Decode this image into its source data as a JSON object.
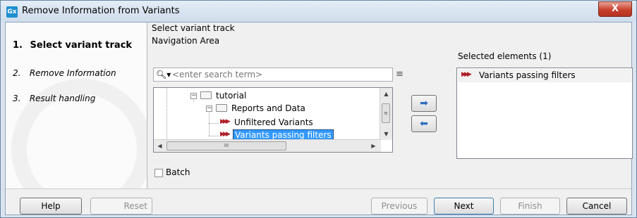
{
  "window": {
    "title": "Remove Information from Variants",
    "app_icon": "Gx",
    "close_label": "X"
  },
  "steps": [
    {
      "num": "1.",
      "label": "Select variant track"
    },
    {
      "num": "2.",
      "label": "Remove Information"
    },
    {
      "num": "3.",
      "label": "Result handling"
    }
  ],
  "main": {
    "section_label": "Select variant track",
    "navigation_label": "Navigation Area",
    "search_placeholder": "<enter search term>",
    "tree": [
      {
        "label": "tutorial"
      },
      {
        "label": "Reports and Data"
      },
      {
        "label": "Unfiltered Variants"
      },
      {
        "label": "Variants passing filters",
        "selected": true
      }
    ],
    "selected_label": "Selected elements (1)",
    "selected_items": [
      "Variants passing filters"
    ],
    "batch_label": "Batch",
    "batch_checked": false
  },
  "footer": {
    "help": "Help",
    "reset": "Reset",
    "previous": "Previous",
    "next": "Next",
    "finish": "Finish",
    "cancel": "Cancel"
  },
  "icons": {
    "search": "magnifier-icon",
    "add": "arrow-right-icon",
    "remove": "arrow-left-icon",
    "variant_track": "variant-track-icon"
  },
  "colors": {
    "selection": "#3399ff",
    "variant_icon": "#b0202a"
  }
}
